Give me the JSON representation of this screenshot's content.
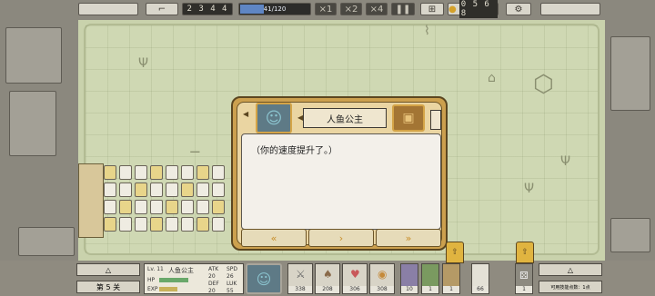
{
  "top_bar": {
    "wave_label": "2 3 4 4",
    "hp_text": "41/120",
    "hp_fraction": 0.34,
    "speed_options": [
      "×1",
      "×2",
      "×4"
    ],
    "score": "0 5 6 8"
  },
  "dialog": {
    "speaker_name": "人鱼公主",
    "message": "（你的速度提升了。）",
    "nav_prev": "«",
    "nav_next": "›",
    "nav_skip": "»"
  },
  "bottom": {
    "stage_label": "第 5 关",
    "unit_name": "人鱼公主",
    "stat_headers": [
      "ATK",
      "SPD",
      "DEF",
      "LUK"
    ],
    "stat_values": [
      "20",
      "26",
      "20",
      "55"
    ],
    "hp_label": "HP",
    "exp_label": "EXP",
    "level_label": "Lv. 11",
    "res_values": [
      "338",
      "208",
      "306",
      "308"
    ],
    "card_values": [
      "10",
      "1",
      "1",
      "66",
      "1"
    ],
    "right_hint": "可用技能点数：1点"
  },
  "colors": {
    "map_bg": "#cfd8b3",
    "dialog_gold": "#cca04e",
    "hp_blue": "#5f86c4"
  }
}
